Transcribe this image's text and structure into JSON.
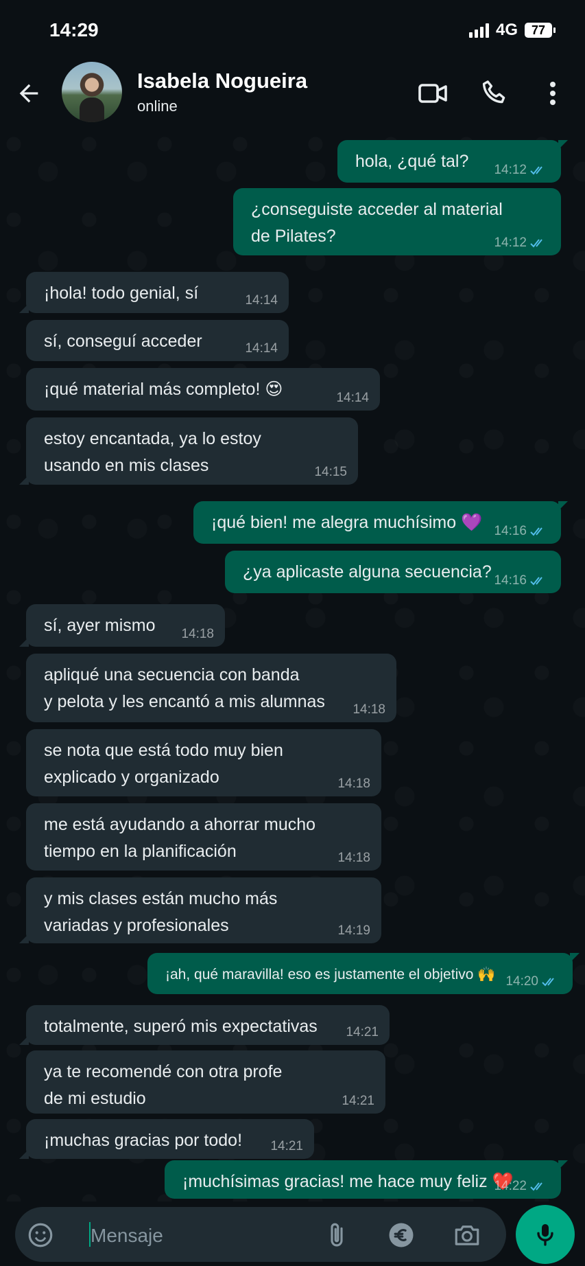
{
  "status_bar": {
    "time": "14:29",
    "network": "4G",
    "battery": "77"
  },
  "header": {
    "contact_name": "Isabela Nogueira",
    "contact_status": "online"
  },
  "messages": [
    {
      "dir": "out",
      "text": "hola, ¿qué tal?",
      "time": "14:12"
    },
    {
      "dir": "out",
      "text": "¿conseguiste acceder al material\nde Pilates?",
      "time": "14:12"
    },
    {
      "dir": "in",
      "text": "¡hola! todo genial, sí",
      "time": "14:14"
    },
    {
      "dir": "in",
      "text": "sí, conseguí acceder",
      "time": "14:14"
    },
    {
      "dir": "in",
      "text": "¡qué material más completo! 😍",
      "time": "14:14"
    },
    {
      "dir": "in",
      "text": "estoy encantada, ya lo estoy\nusando en mis clases",
      "time": "14:15"
    },
    {
      "dir": "out",
      "text": "¡qué bien! me alegra muchísimo 💜",
      "time": "14:16"
    },
    {
      "dir": "out",
      "text": "¿ya aplicaste alguna secuencia?",
      "time": "14:16"
    },
    {
      "dir": "in",
      "text": "sí, ayer mismo",
      "time": "14:18"
    },
    {
      "dir": "in",
      "text": "apliqué una secuencia con banda\ny pelota y les encantó a mis alumnas",
      "time": "14:18"
    },
    {
      "dir": "in",
      "text": "se nota que está todo muy bien\nexplicado y organizado",
      "time": "14:18"
    },
    {
      "dir": "in",
      "text": "me está ayudando a ahorrar mucho\ntiempo en la planificación",
      "time": "14:18"
    },
    {
      "dir": "in",
      "text": "y mis clases están mucho más\nvariadas y profesionales",
      "time": "14:19"
    },
    {
      "dir": "out",
      "text": "¡ah, qué maravilla! eso es justamente el objetivo 🙌",
      "time": "14:20"
    },
    {
      "dir": "in",
      "text": "totalmente, superó mis expectativas",
      "time": "14:21"
    },
    {
      "dir": "in",
      "text": "ya te recomendé con otra profe\nde mi estudio",
      "time": "14:21"
    },
    {
      "dir": "in",
      "text": "¡muchas gracias por todo!",
      "time": "14:21"
    },
    {
      "dir": "out",
      "text": "¡muchísimas gracias! me hace muy feliz ❤️",
      "time": "14:22"
    }
  ],
  "input": {
    "placeholder": "Mensaje"
  },
  "colors": {
    "bubble_in": "#202c33",
    "bubble_out": "#005c4b",
    "accent": "#00a884",
    "read_ticks": "#53bdeb"
  },
  "icons": [
    "back-arrow-icon",
    "video-call-icon",
    "phone-icon",
    "more-vert-icon",
    "emoji-icon",
    "attach-icon",
    "euro-icon",
    "camera-icon",
    "mic-icon"
  ]
}
